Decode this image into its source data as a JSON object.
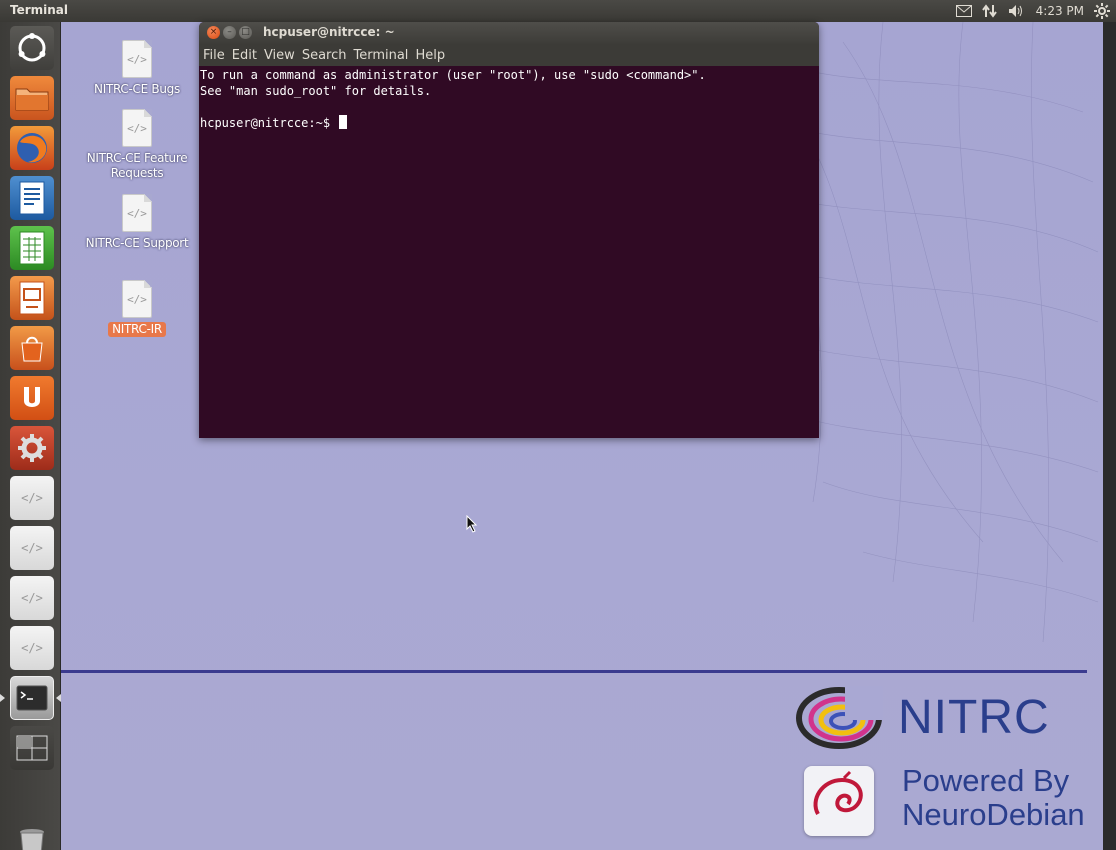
{
  "top_panel": {
    "app_title": "Terminal",
    "clock": "4:23 PM",
    "tray_icons": [
      "mail-icon",
      "network-icon",
      "volume-icon",
      "gear-icon"
    ]
  },
  "launcher": {
    "items": [
      {
        "name": "dash-home-icon"
      },
      {
        "name": "files-icon"
      },
      {
        "name": "firefox-icon"
      },
      {
        "name": "libreoffice-writer-icon"
      },
      {
        "name": "libreoffice-calc-icon"
      },
      {
        "name": "libreoffice-impress-icon"
      },
      {
        "name": "software-center-icon"
      },
      {
        "name": "ubuntu-one-icon"
      },
      {
        "name": "system-settings-icon"
      },
      {
        "name": "html-file-icon"
      },
      {
        "name": "html-file-icon"
      },
      {
        "name": "html-file-icon"
      },
      {
        "name": "html-file-icon"
      },
      {
        "name": "terminal-icon",
        "active": true
      },
      {
        "name": "workspace-switcher-icon"
      },
      {
        "name": "trash-icon"
      }
    ]
  },
  "desktop_icons": [
    {
      "label_line1": "NITRC-CE Bugs",
      "label_line2": ""
    },
    {
      "label_line1": "NITRC-CE Feature",
      "label_line2": "Requests"
    },
    {
      "label_line1": "NITRC-CE Support",
      "label_line2": ""
    },
    {
      "label_line1": "NITRC-IR",
      "label_line2": "",
      "selected": true
    }
  ],
  "terminal": {
    "title": "hcpuser@nitrcce: ~",
    "menu": [
      "File",
      "Edit",
      "View",
      "Search",
      "Terminal",
      "Help"
    ],
    "lines": [
      "To run a command as administrator (user \"root\"), use \"sudo <command>\".",
      "See \"man sudo_root\" for details.",
      "",
      "hcpuser@nitrcce:~$ "
    ]
  },
  "branding": {
    "nitrc": "NITRC",
    "powered_by_line1": "Powered By",
    "powered_by_line2": "NeuroDebian"
  },
  "colors": {
    "desktop_bg": "#a8a8d0",
    "terminal_bg": "#300a24",
    "accent": "#e8784a",
    "brand_blue": "#2a3e8c"
  }
}
